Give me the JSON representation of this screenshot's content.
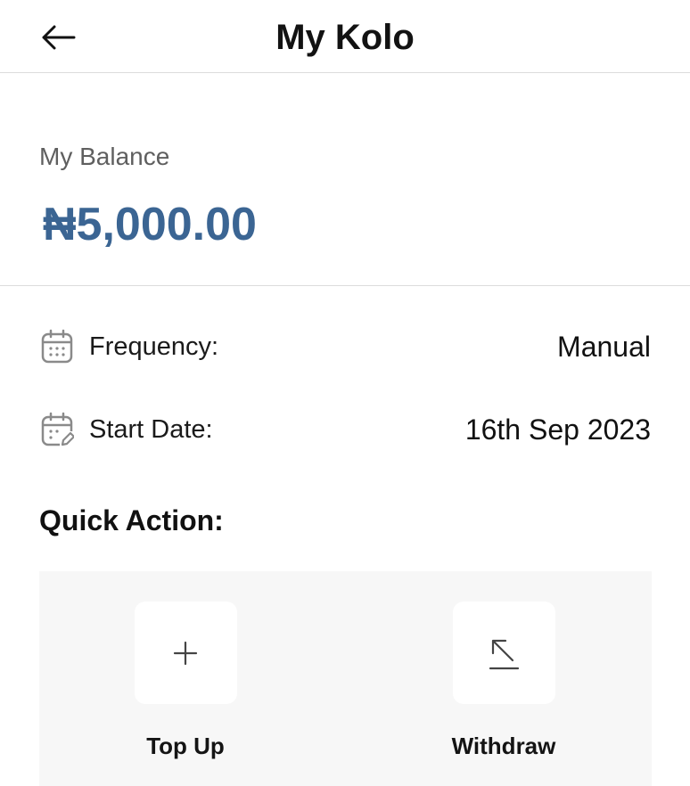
{
  "header": {
    "title": "My Kolo",
    "back_icon": "arrow-left-icon"
  },
  "balance": {
    "label": "My Balance",
    "amount": "₦5,000.00",
    "amount_color": "#3b6593"
  },
  "details": {
    "frequency": {
      "icon": "calendar-icon",
      "label": "Frequency:",
      "value": "Manual"
    },
    "start_date": {
      "icon": "calendar-edit-icon",
      "label": "Start Date:",
      "value": "16th Sep 2023"
    }
  },
  "quick_action": {
    "title": "Quick Action:",
    "actions": [
      {
        "icon": "plus-icon",
        "label": "Top Up"
      },
      {
        "icon": "arrow-up-left-icon",
        "label": "Withdraw"
      }
    ]
  }
}
